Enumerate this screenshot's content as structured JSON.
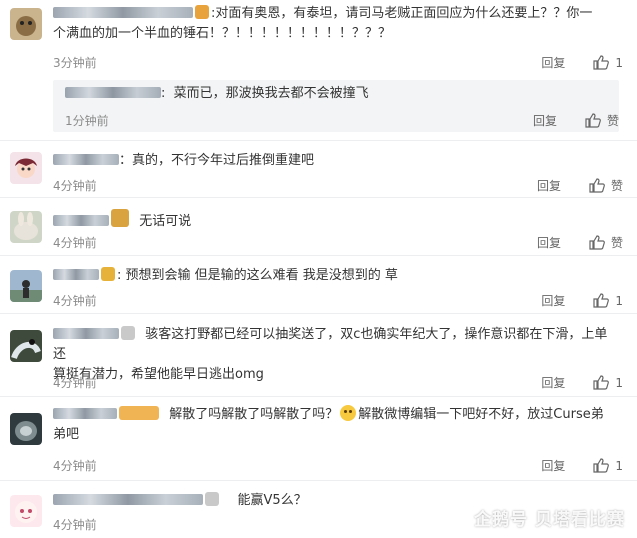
{
  "comments": [
    {
      "text_line1": "对面有奥恩，有泰坦，请司马老贼正面回应为什么还要上？？你一",
      "text_line2": "个满血的加一个半血的锤石！？！！！！！！！！！？？？",
      "time": "3分钟前",
      "reply": "回复",
      "likes": "1",
      "sub_reply": {
        "text": "菜而已，那波换我去都不会被撞飞",
        "time": "1分钟前",
        "reply": "回复",
        "like": "赞"
      }
    },
    {
      "text": "真的，不行今年过后推倒重建吧",
      "time": "4分钟前",
      "reply": "回复",
      "likes": "赞"
    },
    {
      "text": "无话可说",
      "time": "4分钟前",
      "reply": "回复",
      "likes": "赞"
    },
    {
      "text": "预想到会输 但是输的这么难看 我是没想到的 草",
      "time": "4分钟前",
      "reply": "回复",
      "likes": "1"
    },
    {
      "text_line1": "骇客这打野都已经可以抽奖送了，双c也确实年纪大了，操作意识都在下滑，上单还",
      "text_line2": "算挺有潜力，希望他能早日逃出omg",
      "time": "4分钟前",
      "reply": "回复",
      "likes": "1"
    },
    {
      "text_a": "解散了吗解散了吗解散了吗？",
      "text_b": "解散微博编辑一下吧好不好，放过Curse弟",
      "text_line2": "弟吧",
      "time": "4分钟前",
      "reply": "回复",
      "likes": "1"
    },
    {
      "text": "能赢V5么？",
      "time": "4分钟前"
    }
  ],
  "watermark": "企鹅号 贝塔看比赛",
  "colors": {
    "link": "#3b5998",
    "time": "#8b8b8b",
    "divider": "#eceef0",
    "sub_bg": "#f3f4f6"
  }
}
